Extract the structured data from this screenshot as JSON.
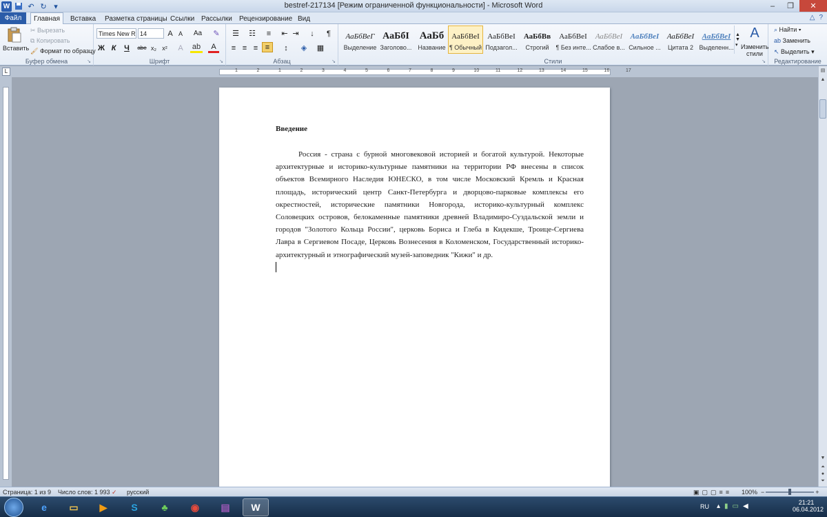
{
  "window": {
    "title": "bestref-217134 [Режим ограниченной функциональности] - Microsoft Word"
  },
  "tabs": [
    "Файл",
    "Главная",
    "Вставка",
    "Разметка страницы",
    "Ссылки",
    "Рассылки",
    "Рецензирование",
    "Вид"
  ],
  "clipboard": {
    "paste": "Вставить",
    "cut": "Вырезать",
    "copy": "Копировать",
    "format_painter": "Формат по образцу",
    "label": "Буфер обмена"
  },
  "font": {
    "name": "Times New Rc",
    "size": "14",
    "label": "Шрифт",
    "bold": "Ж",
    "italic": "К",
    "underline": "Ч",
    "strike": "abe",
    "sub": "x₂",
    "sup": "x²",
    "grow": "A",
    "shrink": "A",
    "case": "Aa",
    "color_a": "A"
  },
  "paragraph": {
    "label": "Абзац",
    "pilcrow": "¶"
  },
  "styles": {
    "label": "Стили",
    "items": [
      {
        "preview": "АаБбВеГ",
        "name": "Выделение"
      },
      {
        "preview": "АаБбI",
        "name": "Заголово..."
      },
      {
        "preview": "АаБб",
        "name": "Название"
      },
      {
        "preview": "АаБбВеI",
        "name": "¶ Обычный"
      },
      {
        "preview": "АаБбВеI",
        "name": "Подзагол..."
      },
      {
        "preview": "АаБбВв",
        "name": "Строгий"
      },
      {
        "preview": "АаБбВеI",
        "name": "¶ Без инте..."
      },
      {
        "preview": "АаБбВеI",
        "name": "Слабое в..."
      },
      {
        "preview": "АаБбВеI",
        "name": "Сильное ..."
      },
      {
        "preview": "АаБбВеI",
        "name": "Цитата 2"
      },
      {
        "preview": "АаБбВеI",
        "name": "Выделенн..."
      }
    ],
    "change_styles": "Изменить стили"
  },
  "editing": {
    "find": "Найти",
    "replace": "Заменить",
    "select": "Выделить",
    "label": "Редактирование"
  },
  "ruler": {
    "numbers": [
      "1",
      "2",
      "1",
      "2",
      "3",
      "4",
      "5",
      "6",
      "7",
      "8",
      "9",
      "10",
      "11",
      "12",
      "13",
      "14",
      "15",
      "16",
      "17"
    ]
  },
  "document": {
    "heading": "Введение",
    "paragraph": "Россия - страна с бурной многовековой историей и богатой культурой. Некоторые архитектурные и историко-культурные памятники на территории РФ внесены в список объектов Всемирного Наследия ЮНЕСКО, в том числе Московский Кремль и Красная площадь, исторический центр Санкт-Петербурга и дворцово-парковые комплексы его окрестностей, исторические памятники Новгорода, историко-культурный комплекс Соловецких островов, белокаменные памятники древней Владимиро-Суздальской земли и городов \"Золотого Кольца России\", церковь Бориса и Глеба в Кидекше, Троице-Сергиева Лавра в Сергиевом Посаде, Церковь Вознесения в Коломенском, Государственный историко-архитектурный и этнографический музей-заповедник \"Кижи\" и др."
  },
  "status": {
    "page": "Страница: 1 из 9",
    "words": "Число слов: 1 993",
    "language": "русский",
    "zoom": "100%"
  },
  "taskbar": {
    "lang": "RU",
    "time": "21:21",
    "date": "06.04.2012"
  }
}
